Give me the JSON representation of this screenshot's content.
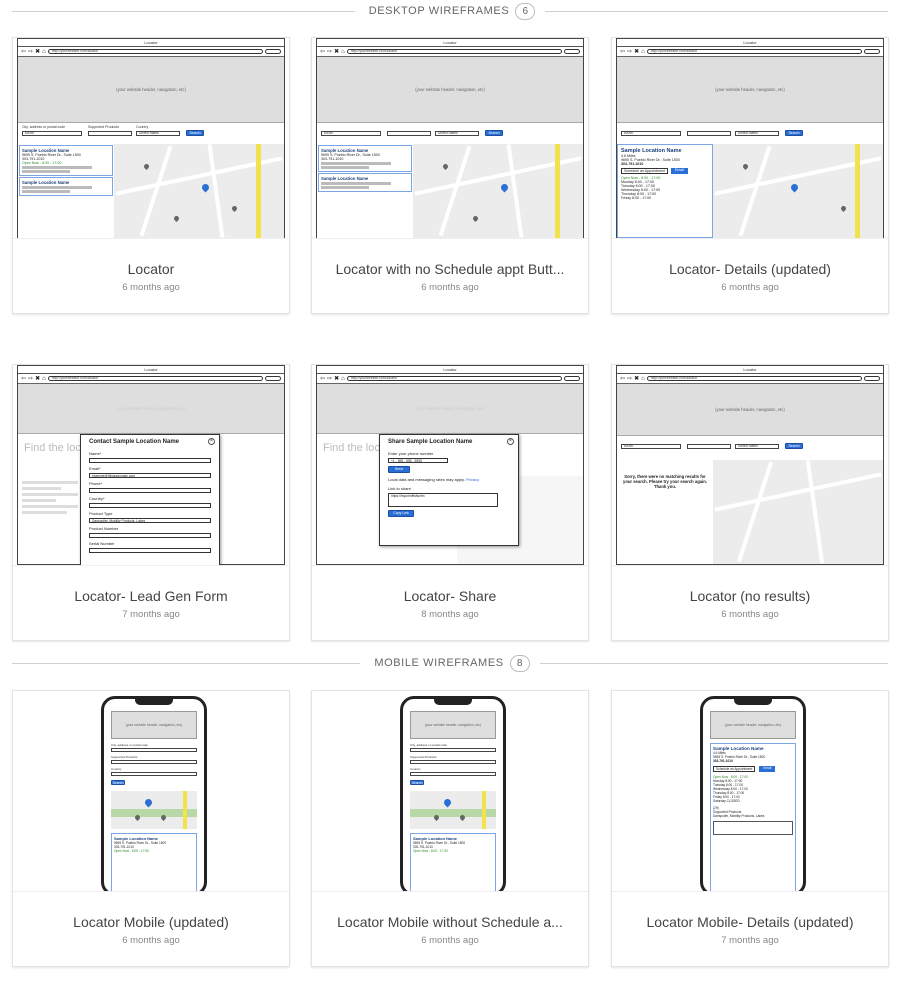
{
  "sections": {
    "desktop": {
      "title": "DESKTOP WIREFRAMES",
      "count": "6"
    },
    "mobile": {
      "title": "MOBILE WIREFRAMES",
      "count": "8"
    }
  },
  "cards": [
    {
      "title": "Locator",
      "date": "6 months ago"
    },
    {
      "title": "Locator with no Schedule appt Butt...",
      "date": "6 months ago"
    },
    {
      "title": "Locator- Details (updated)",
      "date": "6 months ago"
    },
    {
      "title": "Locator- Lead Gen Form",
      "date": "7 months ago"
    },
    {
      "title": "Locator- Share",
      "date": "8 months ago"
    },
    {
      "title": "Locator (no results)",
      "date": "6 months ago"
    },
    {
      "title": "Locator Mobile (updated)",
      "date": "6 months ago"
    },
    {
      "title": "Locator Mobile without Schedule a...",
      "date": "6 months ago"
    },
    {
      "title": "Locator Mobile- Details (updated)",
      "date": "7 months ago"
    }
  ],
  "wireframe": {
    "window_title": "Locator",
    "url": "http://yourwebsite.com/locator",
    "header_placeholder": "(your website header, navigation, etc)",
    "city_label": "City, address or postal code",
    "city_value": "80090",
    "products_label": "Supported Products",
    "country_label": "Country",
    "country_value": "United States",
    "search_btn": "Search",
    "location_name": "Sample Location Name",
    "distance": "4.6 Miles",
    "address": "9695 S. Pueblo River Dr., Suite 1500",
    "city_line": "Denver, CO 80223",
    "directions": "(Get Directions)",
    "phone": "303-791-1010",
    "website": "www.fakeyou.com",
    "open_now": "Open Now - 8:00 - 17:00",
    "reviews": "(29)",
    "products_heading": "Supported Products",
    "products_list": "Danspoiler, Mobility Products, Lakes",
    "schedule_btn": "Schedule an Appointment",
    "email_btn": "Email",
    "details_link": "Details",
    "product_options": [
      "Primary",
      "Scamatic",
      "Image Carriages",
      "Lumnus"
    ],
    "hours": [
      {
        "day": "Monday",
        "time": "8:00 - 17:00"
      },
      {
        "day": "Tuesday",
        "time": "8:00 - 17:00"
      },
      {
        "day": "Wednesday",
        "time": "8:00 - 17:00"
      },
      {
        "day": "Thursday",
        "time": "8:00 - 17:00"
      },
      {
        "day": "Friday",
        "time": "8:00 - 17:00"
      },
      {
        "day": "Saturday",
        "time": "CLOSED"
      }
    ],
    "find_location": "Find the loc",
    "lead_title": "Contact Sample Location Name",
    "lead_fields": [
      "Name*",
      "Email*",
      "Phone*",
      "Country*",
      "Product Type",
      "Product Number",
      "Serial Number"
    ],
    "lead_email": "example@thisisadomain.com",
    "lead_product_type": "Danspoiler, Mobility Products, Lakes",
    "share_title": "Share Sample Location Name",
    "share_phone_label": "Enter your phone number",
    "share_phone": "+1 - 555 - 555 - 5555",
    "share_send": "Send",
    "share_note": "Local data and messaging rates may apply.",
    "share_privacy": "Privacy",
    "share_link_label": "Link to share",
    "share_link": "https://fnyurlmffwfwxfm",
    "share_copy": "Copy Link",
    "no_results": "Sorry, there were no matching results for your search. Please try your search again. Thank you."
  }
}
